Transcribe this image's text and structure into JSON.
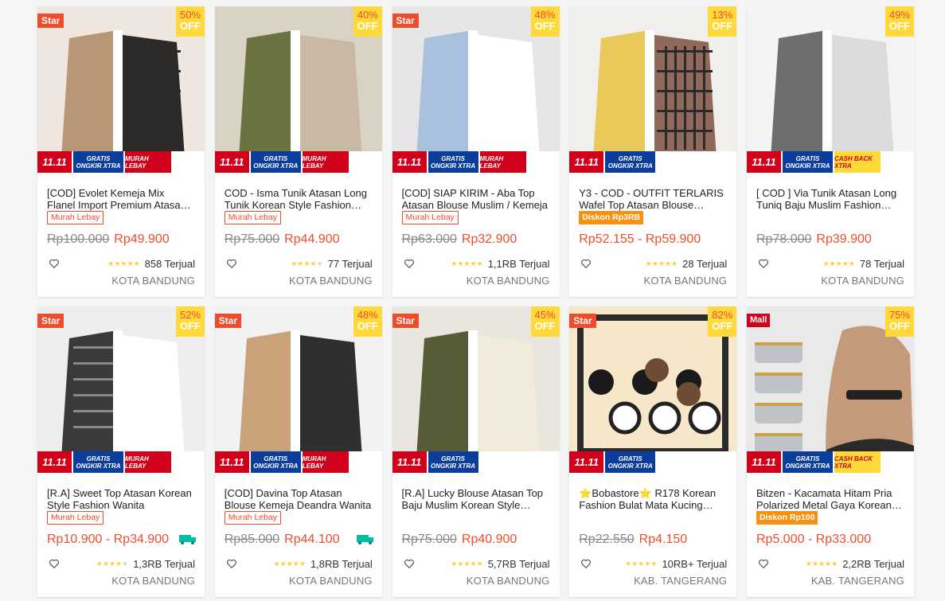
{
  "strip": {
    "t1111": "11.11",
    "gratis": "GRATIS ONGKIR XTRA",
    "murah": "MURAH LEBAY",
    "cash": "CASH BACK XTRA"
  },
  "discount_off": "OFF",
  "products": [
    {
      "badge": "Star",
      "pct": "50%",
      "title": "[COD] Evolet Kemeja Mix Flanel Import Premium Atasan Baju Wanita",
      "tag": "Murah Lebay",
      "tagtype": "murah",
      "orig": "Rp100.000",
      "price": "Rp49.900",
      "rating": 4.5,
      "sold": "858 Terjual",
      "loc": "KOTA BANDUNG",
      "strip3": "murah",
      "palette": [
        "#efe7df",
        "#b79775",
        "#2c2a28"
      ],
      "play": false,
      "free": false
    },
    {
      "badge": "",
      "pct": "40%",
      "title": "COD - Isma Tunik Atasan Long Tunik Korean Style Fashion Muslim",
      "tag": "Murah Lebay",
      "tagtype": "murah",
      "orig": "Rp75.000",
      "price": "Rp44.900",
      "rating": 4,
      "sold": "77 Terjual",
      "loc": "KOTA BANDUNG",
      "strip3": "murah",
      "palette": [
        "#d9d3c6",
        "#6b7340",
        "#c9b8a3"
      ],
      "play": false,
      "free": false
    },
    {
      "badge": "Star",
      "pct": "48%",
      "title": "[COD] SIAP KIRIM - Aba Top Atasan Blouse Muslim / Kemeja",
      "tag": "Murah Lebay",
      "tagtype": "murah",
      "orig": "Rp63.000",
      "price": "Rp32.900",
      "rating": 4.5,
      "sold": "1,1RB Terjual",
      "loc": "KOTA BANDUNG",
      "strip3": "murah",
      "palette": [
        "#e6e6e6",
        "#a9c0de",
        "#ffffff"
      ],
      "play": false,
      "free": false
    },
    {
      "badge": "",
      "pct": "13%",
      "title": "Y3 - COD - OUTFIT TERLARIS Wafel Top Atasan Blouse Wanita",
      "tag": "Diskon Rp3RB",
      "tagtype": "diskon",
      "orig": "",
      "price": "Rp52.155 - Rp59.900",
      "rating": 5,
      "sold": "28 Terjual",
      "loc": "KOTA BANDUNG",
      "strip3": "",
      "palette": [
        "#f1efeb",
        "#e8c95a",
        "#8f6a5c"
      ],
      "play": false,
      "free": false
    },
    {
      "badge": "",
      "pct": "49%",
      "title": "[ COD ] Via Tunik Atasan Long Tuniq Baju Muslim Fashion Wanita",
      "tag": "",
      "tagtype": "",
      "orig": "Rp78.000",
      "price": "Rp39.900",
      "rating": 4.5,
      "sold": "78 Terjual",
      "loc": "KOTA BANDUNG",
      "strip3": "cash",
      "palette": [
        "#f4f4f4",
        "#6e6e6e",
        "#dcdcdc"
      ],
      "play": false,
      "free": false
    },
    {
      "badge": "Star",
      "pct": "52%",
      "title": "[R.A] Sweet Top Atasan Korean Style Fashion Wanita",
      "tag": "Murah Lebay",
      "tagtype": "murah",
      "orig": "",
      "price": "Rp10.900 - Rp34.900",
      "rating": 4,
      "sold": "1,3RB Terjual",
      "loc": "KOTA BANDUNG",
      "strip3": "murah",
      "palette": [
        "#eeeeee",
        "#3a3a3a",
        "#ffffff"
      ],
      "play": false,
      "free": true
    },
    {
      "badge": "Star",
      "pct": "48%",
      "title": "[COD] Davina Top Atasan Blouse Kemeja Deandra Wanita",
      "tag": "Murah Lebay",
      "tagtype": "murah",
      "orig": "Rp85.000",
      "price": "Rp44.100",
      "rating": 5,
      "sold": "1,8RB Terjual",
      "loc": "KOTA BANDUNG",
      "strip3": "murah",
      "palette": [
        "#f2f2f2",
        "#c9a27a",
        "#2f2f2f"
      ],
      "play": false,
      "free": true
    },
    {
      "badge": "Star",
      "pct": "45%",
      "title": "[R.A] Lucky Blouse Atasan Top Baju Muslim Korean Style Wanita",
      "tag": "",
      "tagtype": "",
      "orig": "Rp75.000",
      "price": "Rp40.900",
      "rating": 4.5,
      "sold": "5,7RB Terjual",
      "loc": "KOTA BANDUNG",
      "strip3": "",
      "palette": [
        "#e9e6df",
        "#565d36",
        "#f1ebdc"
      ],
      "play": false,
      "free": false
    },
    {
      "badge": "Star",
      "pct": "82%",
      "title": "⭐Bobastore⭐ R178 Korean Fashion Bulat Mata Kucing Kacamata",
      "tag": "",
      "tagtype": "",
      "orig": "Rp22.550",
      "price": "Rp4.150",
      "rating": 5,
      "sold": "10RB+ Terjual",
      "loc": "KAB. TANGERANG",
      "strip3": "",
      "palette": [
        "#f7e7c9",
        "#1a1a1a",
        "#ffffff"
      ],
      "play": true,
      "free": false
    },
    {
      "badge": "Mall",
      "pct": "75%",
      "title": "Bitzen - Kacamata Hitam Pria Polarized Metal Gaya Korean Style",
      "tag": "Diskon Rp100",
      "tagtype": "diskon",
      "orig": "",
      "price": "Rp5.000 - Rp33.000",
      "rating": 5,
      "sold": "2,2RB Terjual",
      "loc": "KAB. TANGERANG",
      "strip3": "cash",
      "palette": [
        "#f3f3f3",
        "#222222",
        "#c9a24c"
      ],
      "play": true,
      "free": false
    }
  ]
}
